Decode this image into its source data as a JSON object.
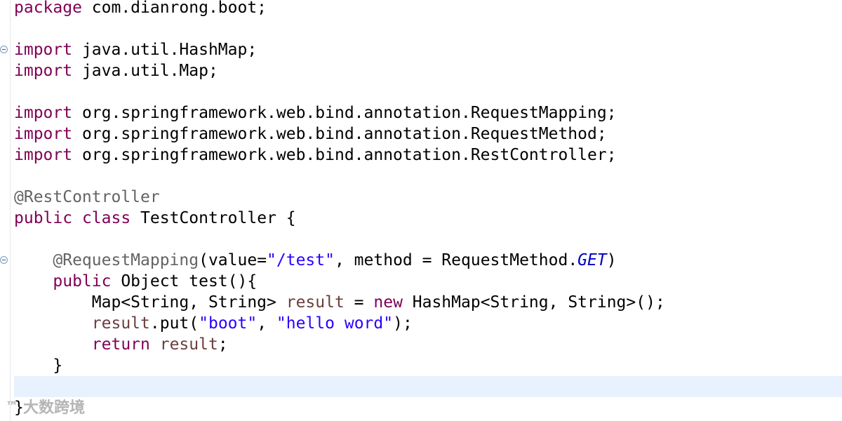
{
  "editor": {
    "code": {
      "l1_kw": "package",
      "l1_rest": " com.dianrong.boot;",
      "import_kw": "import",
      "l3_rest": " java.util.HashMap;",
      "l4_rest": " java.util.Map;",
      "l6_rest": " org.springframework.web.bind.annotation.RequestMapping;",
      "l7_rest": " org.springframework.web.bind.annotation.RequestMethod;",
      "l8_rest": " org.springframework.web.bind.annotation.RestController;",
      "l10_ann": "@RestController",
      "l11_kw1": "public",
      "l11_sp": " ",
      "l11_kw2": "class",
      "l11_rest": " TestController {",
      "l13_indent": "    ",
      "l13_ann": "@RequestMapping",
      "l13_p1": "(value=",
      "l13_str": "\"/test\"",
      "l13_p2": ", method = RequestMethod.",
      "l13_const": "GET",
      "l13_p3": ")",
      "l14_kw": "public",
      "l14_rest": " Object test(){",
      "l15_indent": "        ",
      "l15_p1": "Map<String, String> ",
      "l15_var": "result",
      "l15_p2": " = ",
      "l15_kw": "new",
      "l15_p3": " HashMap<String, String>();",
      "l16_var": "result",
      "l16_p1": ".put(",
      "l16_str1": "\"boot\"",
      "l16_p2": ", ",
      "l16_str2": "\"hello word\"",
      "l16_p3": ");",
      "l17_kw": "return",
      "l17_sp": " ",
      "l17_var": "result",
      "l17_p1": ";",
      "l18_brace": "    }",
      "l20_brace": "}"
    },
    "colors": {
      "keyword": "#7f0055",
      "annotation": "#646464",
      "string": "#2a00ff",
      "variable": "#6a3e3e",
      "constant": "#0000c0",
      "current_line": "#e8f2fe"
    }
  },
  "watermark": {
    "logo": "™",
    "text": "大数跨境"
  }
}
